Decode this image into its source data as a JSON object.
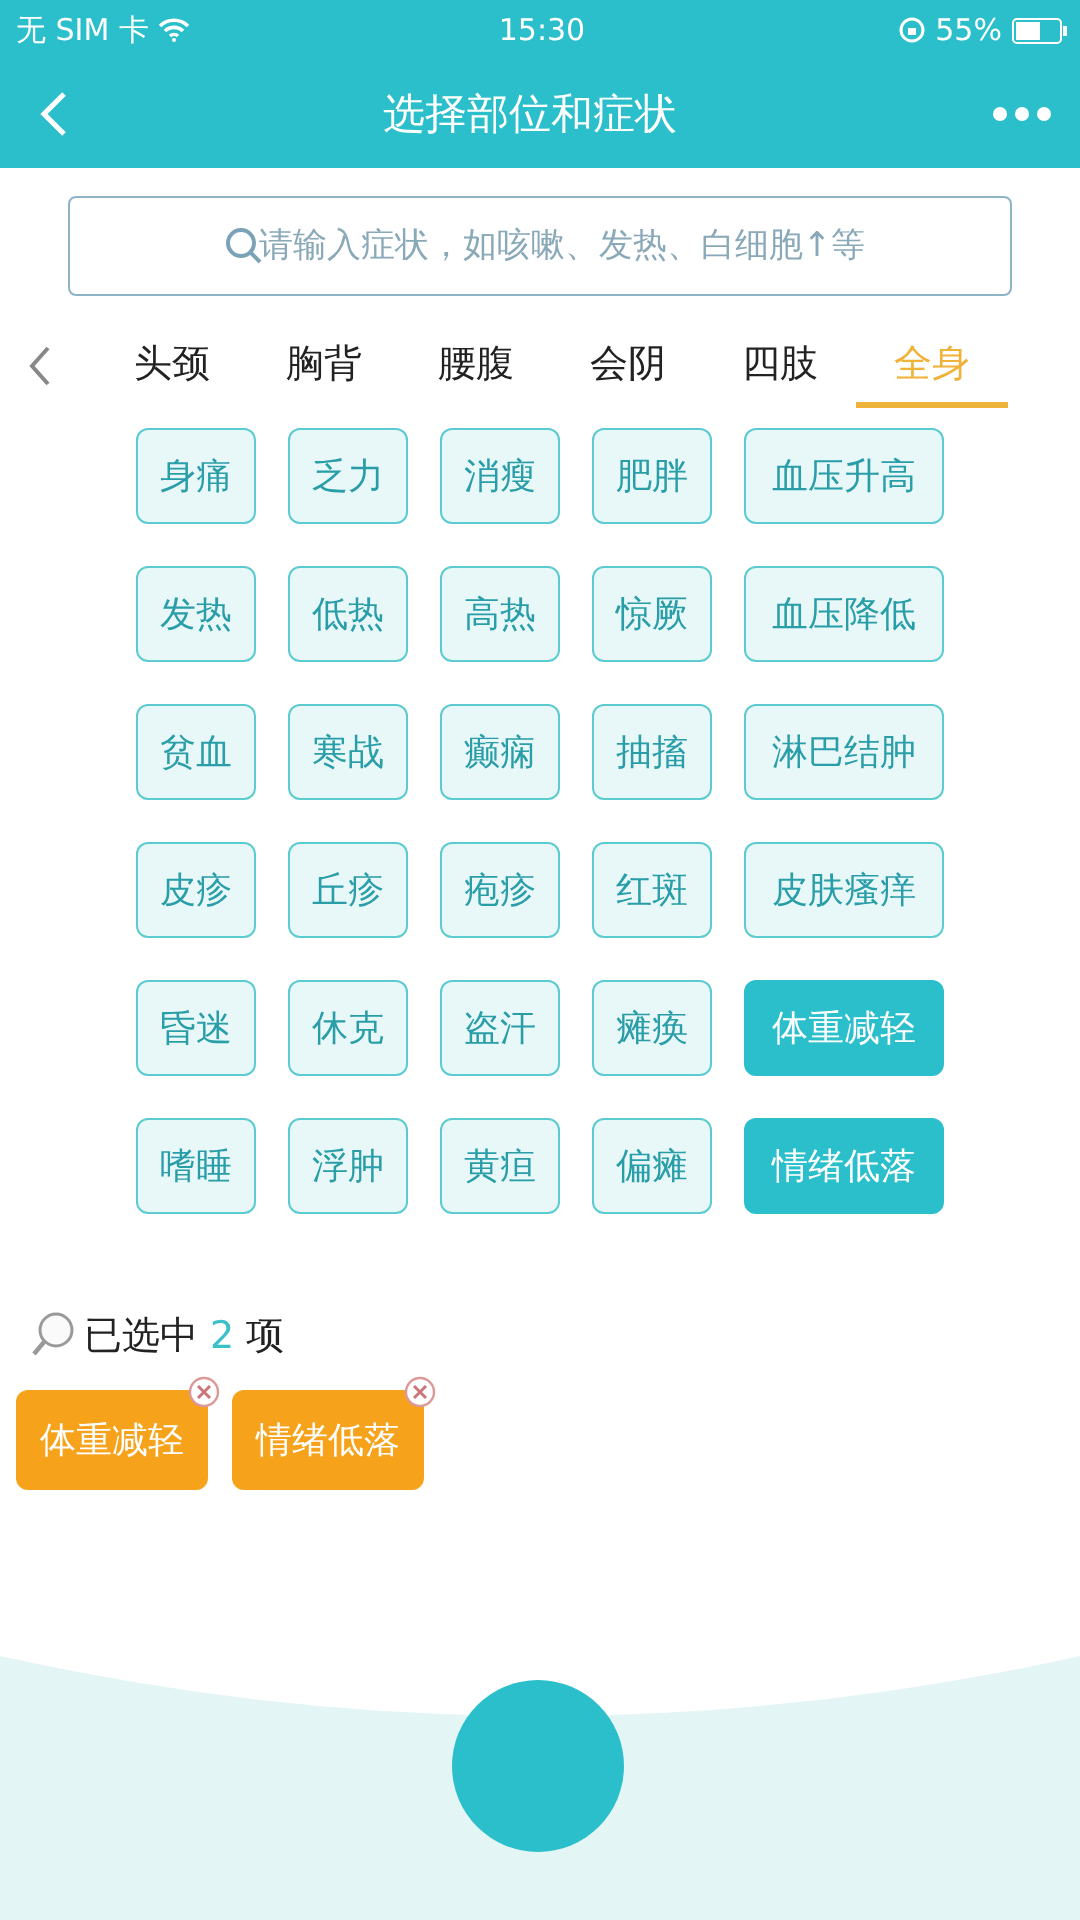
{
  "status_bar": {
    "carrier": "无 SIM 卡",
    "time": "15:30",
    "battery": "55%"
  },
  "nav": {
    "title": "选择部位和症状"
  },
  "search": {
    "placeholder": "请输入症状，如咳嗽、发热、白细胞↑等"
  },
  "body_tabs": [
    {
      "label": "头颈",
      "selected": false
    },
    {
      "label": "胸背",
      "selected": false
    },
    {
      "label": "腰腹",
      "selected": false
    },
    {
      "label": "会阴",
      "selected": false
    },
    {
      "label": "四肢",
      "selected": false
    },
    {
      "label": "全身",
      "selected": true
    }
  ],
  "symptoms": [
    {
      "label": "身痛",
      "selected": false
    },
    {
      "label": "乏力",
      "selected": false
    },
    {
      "label": "消瘦",
      "selected": false
    },
    {
      "label": "肥胖",
      "selected": false
    },
    {
      "label": "血压升高",
      "selected": false
    },
    {
      "label": "发热",
      "selected": false
    },
    {
      "label": "低热",
      "selected": false
    },
    {
      "label": "高热",
      "selected": false
    },
    {
      "label": "惊厥",
      "selected": false
    },
    {
      "label": "血压降低",
      "selected": false
    },
    {
      "label": "贫血",
      "selected": false
    },
    {
      "label": "寒战",
      "selected": false
    },
    {
      "label": "癫痫",
      "selected": false
    },
    {
      "label": "抽搐",
      "selected": false
    },
    {
      "label": "淋巴结肿",
      "selected": false
    },
    {
      "label": "皮疹",
      "selected": false
    },
    {
      "label": "丘疹",
      "selected": false
    },
    {
      "label": "疱疹",
      "selected": false
    },
    {
      "label": "红斑",
      "selected": false
    },
    {
      "label": "皮肤瘙痒",
      "selected": false
    },
    {
      "label": "昏迷",
      "selected": false
    },
    {
      "label": "休克",
      "selected": false
    },
    {
      "label": "盗汗",
      "selected": false
    },
    {
      "label": "瘫痪",
      "selected": false
    },
    {
      "label": "体重减轻",
      "selected": true
    },
    {
      "label": "嗜睡",
      "selected": false
    },
    {
      "label": "浮肿",
      "selected": false
    },
    {
      "label": "黄疸",
      "selected": false
    },
    {
      "label": "偏瘫",
      "selected": false
    },
    {
      "label": "情绪低落",
      "selected": true
    }
  ],
  "selection": {
    "prefix": "已选中",
    "count": "2",
    "suffix": "项"
  },
  "selected_tags": [
    "体重减轻",
    "情绪低落"
  ]
}
